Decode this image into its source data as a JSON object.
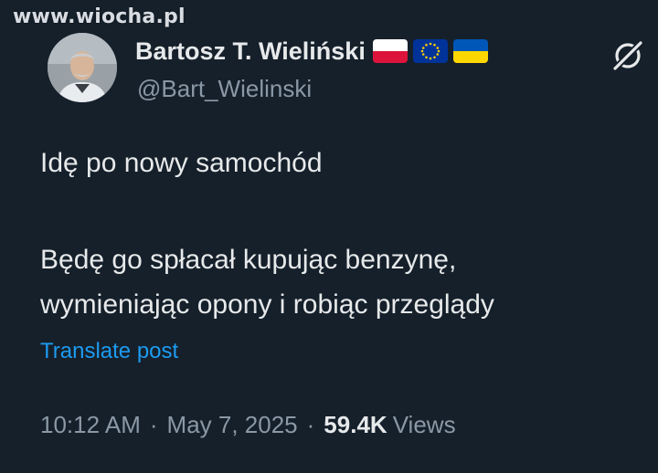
{
  "watermark": "www.wiocha.pl",
  "author": {
    "name": "Bartosz T. Wieliński",
    "handle": "@Bart_Wielinski",
    "flags": [
      "poland-flag",
      "eu-flag",
      "ukraine-flag"
    ]
  },
  "post": {
    "lines": [
      "Idę po nowy samochód",
      "Będę go spłacał kupując benzynę,",
      "wymieniając opony i robiąc przeglądy"
    ],
    "translate_label": "Translate post"
  },
  "meta": {
    "time": "10:12 AM",
    "date": "May 7, 2025",
    "views_count": "59.4K",
    "views_label": "Views"
  },
  "icons": {
    "grok": "grok-icon",
    "avatar": "avatar"
  },
  "colors": {
    "background": "#15202b",
    "text": "#e7e9ea",
    "muted": "#8b98a5",
    "link": "#1d9bf0"
  }
}
